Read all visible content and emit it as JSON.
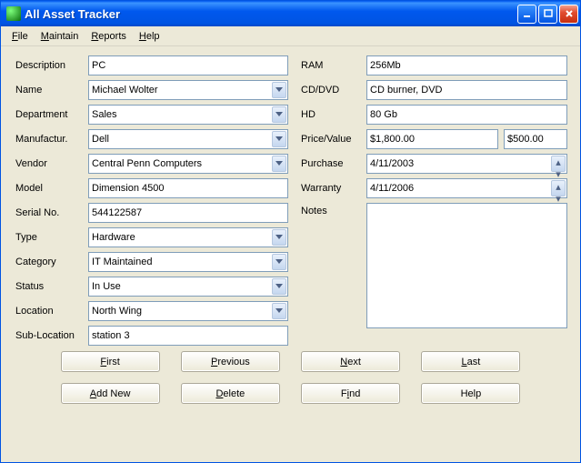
{
  "window": {
    "title": "All Asset Tracker"
  },
  "menu": {
    "file": "File",
    "maintain": "Maintain",
    "reports": "Reports",
    "help": "Help"
  },
  "labels": {
    "description": "Description",
    "name": "Name",
    "department": "Department",
    "manufactur": "Manufactur.",
    "vendor": "Vendor",
    "model": "Model",
    "serialno": "Serial No.",
    "type": "Type",
    "category": "Category",
    "status": "Status",
    "location": "Location",
    "sublocation": "Sub-Location",
    "ram": "RAM",
    "cddvd": "CD/DVD",
    "hd": "HD",
    "pricevalue": "Price/Value",
    "purchase": "Purchase",
    "warranty": "Warranty",
    "notes": "Notes"
  },
  "values": {
    "description": "PC",
    "name": "Michael Wolter",
    "department": "Sales",
    "manufactur": "Dell",
    "vendor": "Central Penn Computers",
    "model": "Dimension 4500",
    "serialno": "544122587",
    "type": "Hardware",
    "category": "IT Maintained",
    "status": "In Use",
    "location": "North Wing",
    "sublocation": "station 3",
    "ram": "256Mb",
    "cddvd": "CD burner, DVD",
    "hd": "80 Gb",
    "price": "$1,800.00",
    "value": "$500.00",
    "purchase": "4/11/2003",
    "warranty": "4/11/2006",
    "notes": ""
  },
  "buttons": {
    "first": "First",
    "previous": "Previous",
    "next": "Next",
    "last": "Last",
    "addnew": "Add New",
    "delete": "Delete",
    "find": "Find",
    "help": "Help"
  }
}
